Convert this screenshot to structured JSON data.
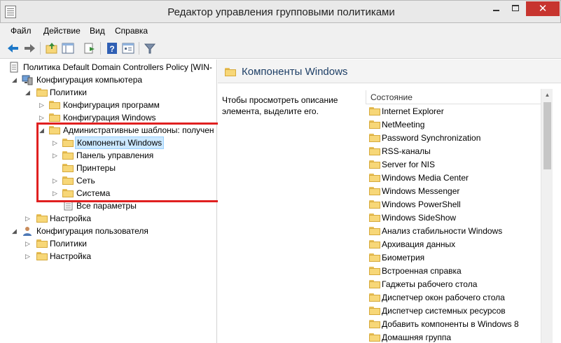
{
  "window": {
    "title": "Редактор управления групповыми политиками",
    "close_glyph": "✕"
  },
  "menu": [
    "Файл",
    "Действие",
    "Вид",
    "Справка"
  ],
  "toolbar": {
    "icons": [
      "back-icon",
      "forward-icon",
      "up-folder-icon",
      "show-tree-icon",
      "export-list-icon",
      "help-icon",
      "properties-icon",
      "filter-icon"
    ]
  },
  "tree": [
    {
      "label": "Политика Default Domain Controllers Policy [WIN-",
      "arrow": "",
      "icon": "policy-doc-icon"
    },
    {
      "label": "Конфигурация компьютера",
      "arrow": "◢",
      "icon": "computer-icon"
    },
    {
      "label": "Политики",
      "arrow": "◢",
      "icon": "folder-icon"
    },
    {
      "label": "Конфигурация программ",
      "arrow": "▷",
      "icon": "folder-icon"
    },
    {
      "label": "Конфигурация Windows",
      "arrow": "▷",
      "icon": "folder-icon"
    },
    {
      "label": "Административные шаблоны: получен",
      "arrow": "◢",
      "icon": "folder-icon"
    },
    {
      "label": "Компоненты Windows",
      "arrow": "▷",
      "icon": "folder-icon",
      "selected": true
    },
    {
      "label": "Панель управления",
      "arrow": "▷",
      "icon": "folder-icon"
    },
    {
      "label": "Принтеры",
      "arrow": "",
      "icon": "folder-icon"
    },
    {
      "label": "Сеть",
      "arrow": "▷",
      "icon": "folder-icon"
    },
    {
      "label": "Система",
      "arrow": "▷",
      "icon": "folder-icon"
    },
    {
      "label": "Все параметры",
      "arrow": "",
      "icon": "settings-list-icon"
    },
    {
      "label": "Настройка",
      "arrow": "▷",
      "icon": "folder-icon"
    },
    {
      "label": "Конфигурация пользователя",
      "arrow": "◢",
      "icon": "user-icon"
    },
    {
      "label": "Политики",
      "arrow": "▷",
      "icon": "folder-icon"
    },
    {
      "label": "Настройка",
      "arrow": "▷",
      "icon": "folder-icon"
    }
  ],
  "right": {
    "title": "Компоненты Windows",
    "description": "Чтобы просмотреть описание элемента, выделите его.",
    "column_header": "Состояние",
    "items": [
      "Internet Explorer",
      "NetMeeting",
      "Password Synchronization",
      "RSS-каналы",
      "Server for NIS",
      "Windows Media Center",
      "Windows Messenger",
      "Windows PowerShell",
      "Windows SideShow",
      "Анализ стабильности Windows",
      "Архивация данных",
      "Биометрия",
      "Встроенная справка",
      "Гаджеты рабочего стола",
      "Диспетчер окон рабочего стола",
      "Диспетчер системных ресурсов",
      "Добавить компоненты в Windows 8",
      "Домашняя группа"
    ]
  },
  "colors": {
    "highlight": "#e02020",
    "selection": "#cce8ff",
    "folder": "#f7d778",
    "close_button": "#c7352f"
  }
}
